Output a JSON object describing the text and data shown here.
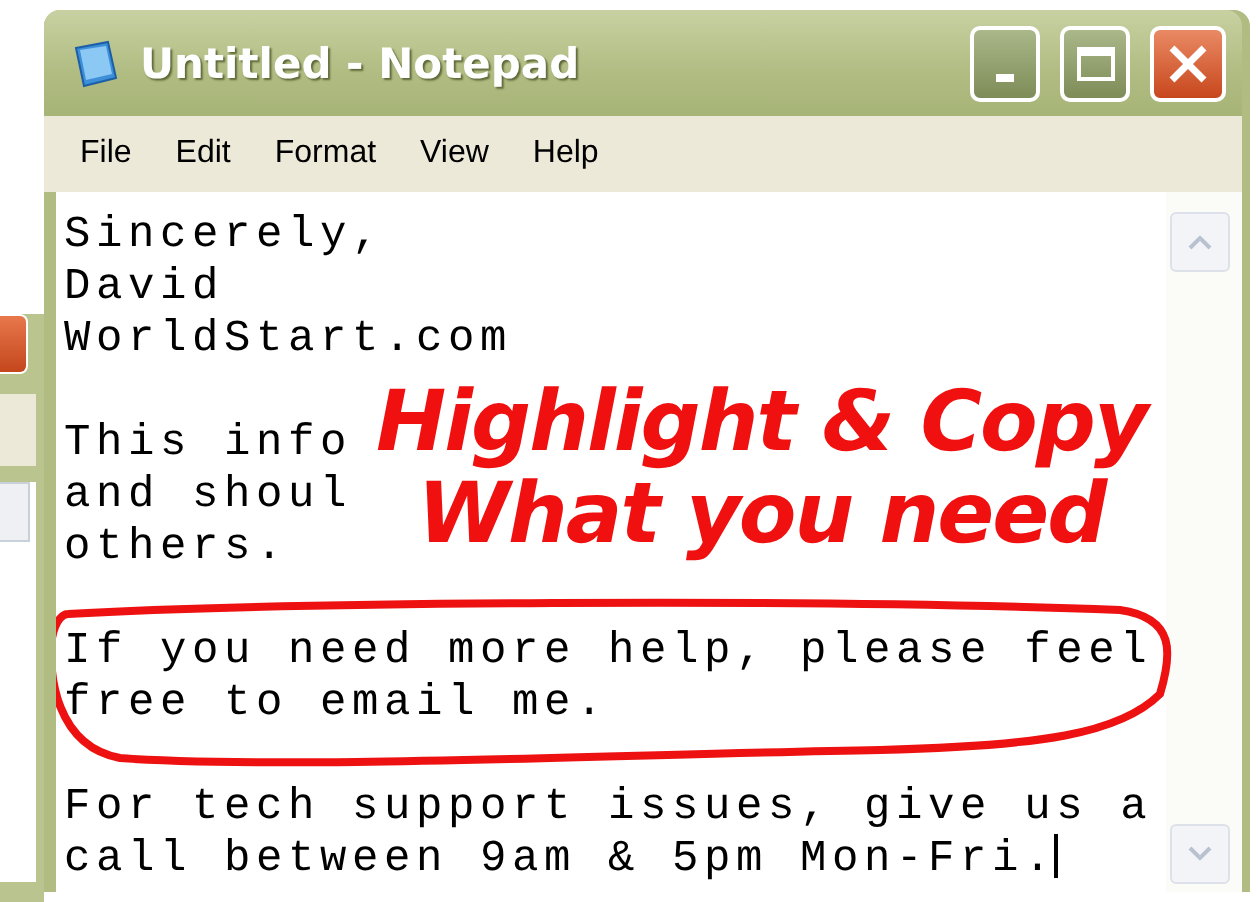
{
  "window": {
    "title": "Untitled - Notepad"
  },
  "menu": [
    "File",
    "Edit",
    "Format",
    "View",
    "Help"
  ],
  "editor": {
    "paragraphs": [
      {
        "lines": [
          "Sincerely,",
          "David",
          "WorldStart.com"
        ],
        "circled": false
      },
      {
        "lines": [
          "This info",
          "and shoul",
          "others."
        ],
        "circled": false
      },
      {
        "lines": [
          "If you need more help, please feel",
          "free to email me."
        ],
        "circled": true
      },
      {
        "lines": [
          "For tech support issues, give us a",
          "call between 9am & 5pm Mon-Fri."
        ],
        "circled": false
      }
    ],
    "caret": true
  },
  "annotation": {
    "lines": [
      "Highlight & Copy",
      "What you need"
    ]
  }
}
